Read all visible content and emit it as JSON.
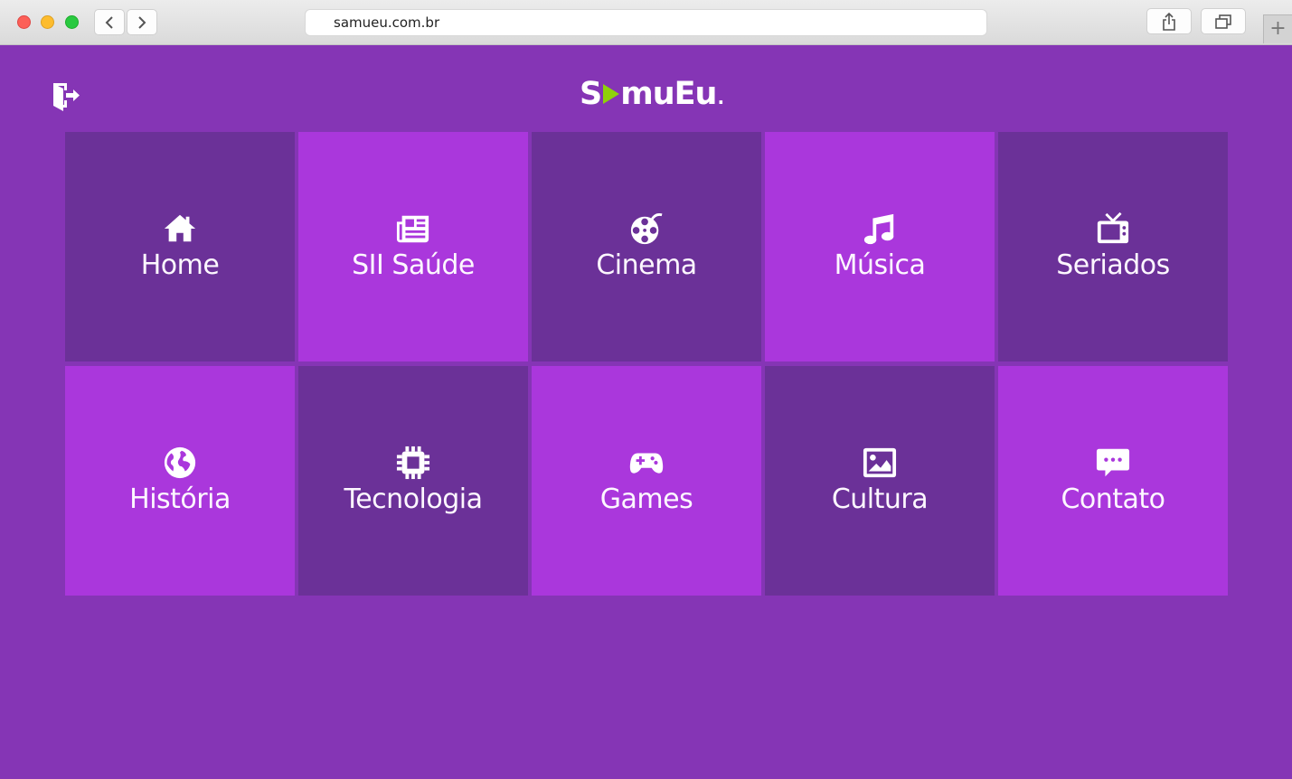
{
  "browser": {
    "url": "samueu.com.br"
  },
  "header": {
    "logo_text_left": "S",
    "logo_text_right": "muEu",
    "logo_dot": ".",
    "logout_icon": "sign-out-icon"
  },
  "colors": {
    "page_background": "#8535b5",
    "tile_dark": "#6b3198",
    "tile_light": "#aa37dc",
    "logo_accent": "#8fd10a"
  },
  "tiles": [
    {
      "label": "Home",
      "icon": "home-icon",
      "tone": "dark"
    },
    {
      "label": "SII Saúde",
      "icon": "newspaper-icon",
      "tone": "light"
    },
    {
      "label": "Cinema",
      "icon": "film-reel-icon",
      "tone": "dark"
    },
    {
      "label": "Música",
      "icon": "music-note-icon",
      "tone": "light"
    },
    {
      "label": "Seriados",
      "icon": "tv-icon",
      "tone": "dark"
    },
    {
      "label": "História",
      "icon": "globe-icon",
      "tone": "light"
    },
    {
      "label": "Tecnologia",
      "icon": "chip-icon",
      "tone": "dark"
    },
    {
      "label": "Games",
      "icon": "gamepad-icon",
      "tone": "light"
    },
    {
      "label": "Cultura",
      "icon": "image-icon",
      "tone": "dark"
    },
    {
      "label": "Contato",
      "icon": "chat-bubble-icon",
      "tone": "light"
    }
  ]
}
